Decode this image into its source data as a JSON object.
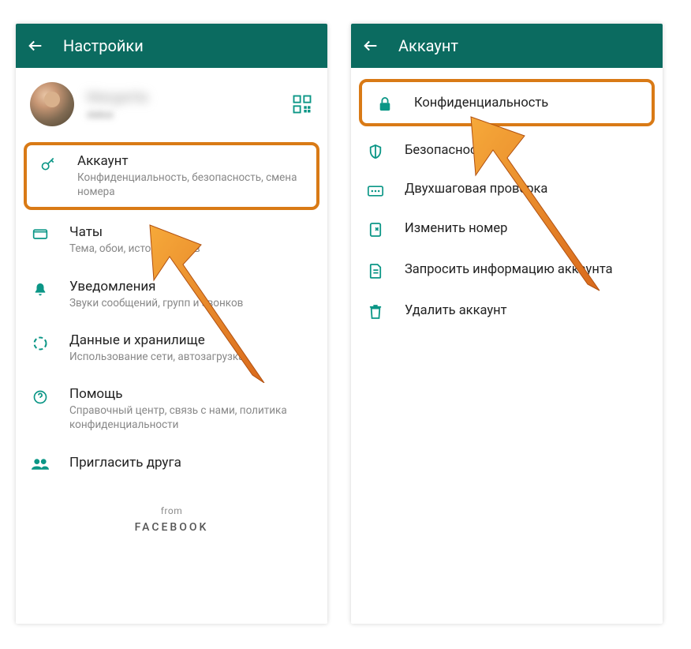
{
  "left": {
    "header_title": "Настройки",
    "profile_name": "Margarita",
    "items": {
      "account": {
        "title": "Аккаунт",
        "sub": "Конфиденциальность, безопасность, смена номера"
      },
      "chats": {
        "title": "Чаты",
        "sub": "Тема, обои, история чатов"
      },
      "notif": {
        "title": "Уведомления",
        "sub": "Звуки сообщений, групп и звонков"
      },
      "data": {
        "title": "Данные и хранилище",
        "sub": "Использование сети, автозагрузка"
      },
      "help": {
        "title": "Помощь",
        "sub": "Справочный центр, связь с нами, политика конфиденциальности"
      },
      "invite": {
        "title": "Пригласить друга"
      }
    },
    "footer_from": "from",
    "footer_brand": "FACEBOOK"
  },
  "right": {
    "header_title": "Аккаунт",
    "items": {
      "privacy": "Конфиденциальность",
      "security": "Безопасность",
      "twostep": "Двухшаговая проверка",
      "changenum": "Изменить номер",
      "request": "Запросить информацию аккаунта",
      "delete": "Удалить аккаунт"
    }
  }
}
